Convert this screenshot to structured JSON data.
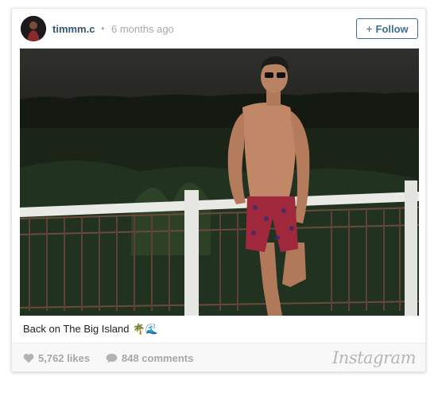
{
  "post": {
    "username": "timmm.c",
    "separator": "•",
    "timestamp": "6 months ago",
    "follow_label": "Follow",
    "caption": "Back on The Big Island",
    "caption_emoji": "🌴🌊",
    "likes": "5,762 likes",
    "comments": "848 comments",
    "brand": "Instagram"
  },
  "icons": {
    "avatar": "avatar",
    "follow": "plus-icon",
    "likes": "heart-icon",
    "comments": "comment-bubble-icon"
  },
  "colors": {
    "username": "#36566f",
    "follow_button": "#3f6d8e",
    "muted": "#a7a7a7"
  }
}
